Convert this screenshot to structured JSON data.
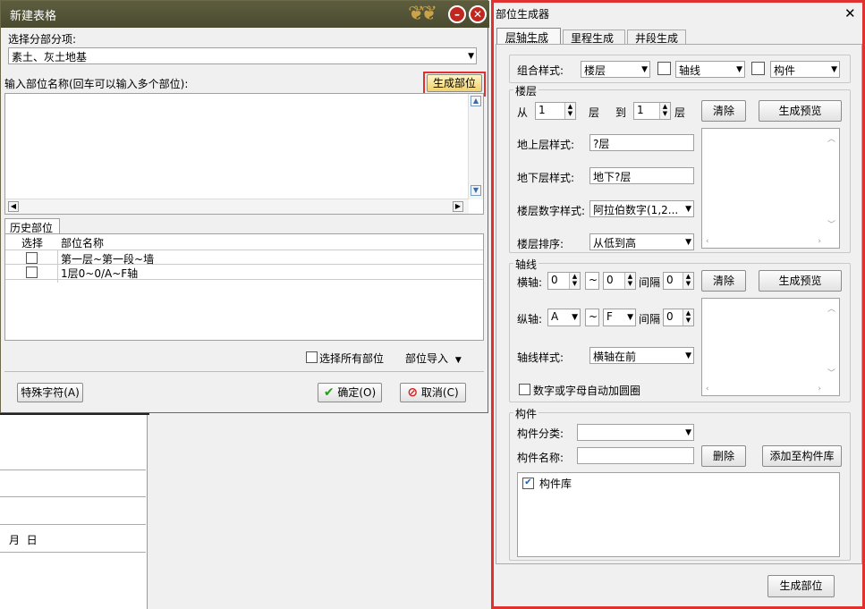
{
  "left_dialog": {
    "title": "新建表格",
    "select_label": "选择分部分项:",
    "select_value": "素土、灰土地基",
    "input_label": "输入部位名称(回车可以输入多个部位):",
    "generate_btn": "生成部位",
    "history_tab": "历史部位",
    "col_select": "选择",
    "col_name": "部位名称",
    "rows": [
      "第一层~第一段~墙",
      "1层0~0/A~F轴"
    ],
    "select_all": "选择所有部位",
    "import": "部位导入",
    "special_btn": "特殊字符(A)",
    "ok_btn": "确定(O)",
    "cancel_btn": "取消(C)"
  },
  "background": {
    "date_text": "月  日"
  },
  "right_dialog": {
    "title": "部位生成器",
    "close": "✕",
    "tabs": [
      "层轴生成",
      "里程生成",
      "井段生成"
    ],
    "combo_label": "组合样式:",
    "combo1": "楼层",
    "combo2": "轴线",
    "combo3": "构件",
    "floor": {
      "group": "楼层",
      "from": "从",
      "from_val": "1",
      "ceng1": "层",
      "to": "到",
      "to_val": "1",
      "ceng2": "层",
      "clear": "清除",
      "preview": "生成预览",
      "above_label": "地上层样式:",
      "above_val": "?层",
      "below_label": "地下层样式:",
      "below_val": "地下?层",
      "num_label": "楼层数字样式:",
      "num_val": "阿拉伯数字(1,2...",
      "order_label": "楼层排序:",
      "order_val": "从低到高"
    },
    "axis": {
      "group": "轴线",
      "h_label": "横轴:",
      "h_from": "0",
      "tilde": "~",
      "h_to": "0",
      "interval": "间隔",
      "h_int": "0",
      "v_label": "纵轴:",
      "v_from": "A",
      "v_to": "F",
      "v_int": "0",
      "clear": "清除",
      "preview": "生成预览",
      "style_label": "轴线样式:",
      "style_val": "横轴在前",
      "circle": "数字或字母自动加圆圈"
    },
    "component": {
      "group": "构件",
      "class_label": "构件分类:",
      "name_label": "构件名称:",
      "delete": "删除",
      "add": "添加至构件库",
      "tree_root": "构件库"
    },
    "generate": "生成部位"
  }
}
